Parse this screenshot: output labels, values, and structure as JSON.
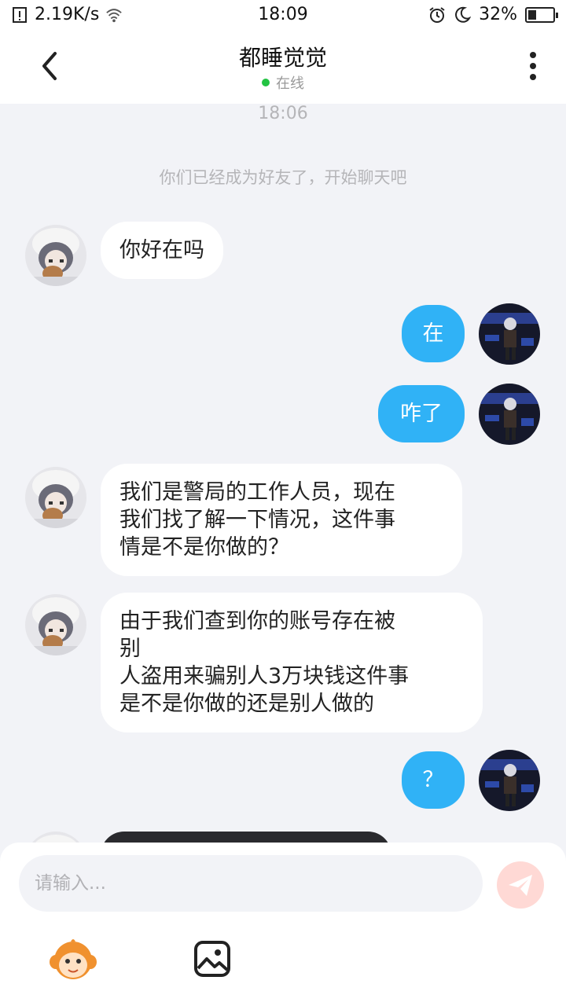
{
  "status_bar": {
    "network_speed": "2.19K/s",
    "time": "18:09",
    "battery": "32%",
    "battery_level": 0.32
  },
  "header": {
    "title": "都睡觉觉",
    "status": "在线"
  },
  "chat": {
    "timestamp": "18:06",
    "system_message": "你们已经成为好友了，开始聊天吧",
    "messages": [
      {
        "side": "in",
        "text": "你好在吗"
      },
      {
        "side": "out",
        "text": "在"
      },
      {
        "side": "out",
        "text": "咋了"
      },
      {
        "side": "in",
        "lines": [
          "我们是警局的工作人员，现在",
          "我们找了解一下情况，这件事",
          "情是不是你做的？"
        ]
      },
      {
        "side": "in",
        "lines": [
          "由于我们查到你的账号存在被",
          "别",
          "人盗用来骗别人3万块钱这件事",
          "是不是你做的还是别人做的"
        ]
      },
      {
        "side": "out",
        "text": "？"
      }
    ]
  },
  "input": {
    "placeholder": "请输入..."
  },
  "colors": {
    "accent": "#30b2f6",
    "online": "#23c343",
    "send_disabled": "#ffd9d5"
  }
}
